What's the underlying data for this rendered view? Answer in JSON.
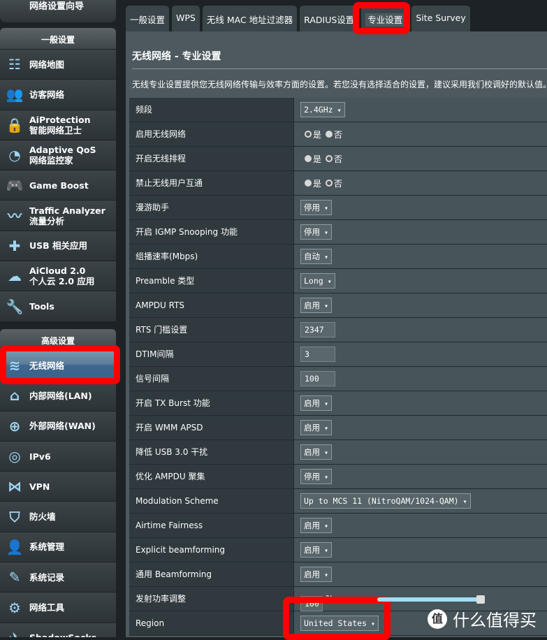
{
  "sidebar": {
    "wizard": "网络设置向导",
    "general_header": "一般设置",
    "general": [
      {
        "icon": "network-map-icon",
        "glyph": "☷",
        "label": "网络地图"
      },
      {
        "icon": "guest-network-icon",
        "glyph": "👥",
        "label": "访客网络"
      },
      {
        "icon": "lock-icon",
        "glyph": "🔒",
        "label": "AiProtection\n智能网络卫士"
      },
      {
        "icon": "gauge-icon",
        "glyph": "◔",
        "label": "Adaptive QoS\n网络监控家"
      },
      {
        "icon": "gamepad-icon",
        "glyph": "🎮",
        "label": "Game Boost"
      },
      {
        "icon": "chart-icon",
        "glyph": "〰",
        "label": "Traffic Analyzer\n流量分析"
      },
      {
        "icon": "puzzle-icon",
        "glyph": "✚",
        "label": "USB 相关应用"
      },
      {
        "icon": "cloud-icon",
        "glyph": "☁",
        "label": "AiCloud 2.0\n个人云 2.0 应用"
      },
      {
        "icon": "wrench-icon",
        "glyph": "🔧",
        "label": "Tools"
      }
    ],
    "advanced_header": "高级设置",
    "advanced": [
      {
        "icon": "wifi-icon",
        "glyph": "≋",
        "label": "无线网络",
        "active": true
      },
      {
        "icon": "home-icon",
        "glyph": "⌂",
        "label": "内部网络(LAN)"
      },
      {
        "icon": "globe-icon",
        "glyph": "⊕",
        "label": "外部网络(WAN)"
      },
      {
        "icon": "ipv6-icon",
        "glyph": "◎",
        "label": "IPv6"
      },
      {
        "icon": "vpn-icon",
        "glyph": "⋈",
        "label": "VPN"
      },
      {
        "icon": "shield-icon",
        "glyph": "⛉",
        "label": "防火墙"
      },
      {
        "icon": "admin-icon",
        "glyph": "👤",
        "label": "系统管理"
      },
      {
        "icon": "log-icon",
        "glyph": "✎",
        "label": "系统记录"
      },
      {
        "icon": "tools-icon",
        "glyph": "⚙",
        "label": "网络工具"
      },
      {
        "icon": "shadowsocks-icon",
        "glyph": "✈",
        "label": "ShadowSocks"
      }
    ]
  },
  "tabs": [
    {
      "label": "一般设置"
    },
    {
      "label": "WPS"
    },
    {
      "label": "无线 MAC 地址过滤器"
    },
    {
      "label": "RADIUS设置"
    },
    {
      "label": "专业设置",
      "selected": true
    },
    {
      "label": "Site Survey"
    }
  ],
  "page": {
    "title": "无线网络 - 专业设置",
    "description": "无线专业设置提供您无线网络传输与效率方面的设置。若您没有选择适合的设置，建议采用我们校调好的默认值。"
  },
  "radio_labels": {
    "yes": "是",
    "no": "否"
  },
  "rows": [
    {
      "label": "频段",
      "type": "select",
      "value": "2.4GHz"
    },
    {
      "label": "启用无线网络",
      "type": "radio",
      "value": "yes"
    },
    {
      "label": "开启无线排程",
      "type": "radio",
      "value": "no"
    },
    {
      "label": "禁止无线用户互通",
      "type": "radio",
      "value": "no"
    },
    {
      "label": "漫游助手",
      "type": "select",
      "value": "停用"
    },
    {
      "label": "开启 IGMP Snooping 功能",
      "type": "select",
      "value": "停用"
    },
    {
      "label": "组播速率(Mbps)",
      "type": "select",
      "value": "自动"
    },
    {
      "label": "Preamble 类型",
      "type": "select",
      "value": "Long"
    },
    {
      "label": "AMPDU RTS",
      "type": "select",
      "value": "启用"
    },
    {
      "label": "RTS 门槛设置",
      "type": "input",
      "value": "2347"
    },
    {
      "label": "DTIM间隔",
      "type": "input",
      "value": "3"
    },
    {
      "label": "信号间隔",
      "type": "input",
      "value": "100"
    },
    {
      "label": "开启 TX Burst 功能",
      "type": "select",
      "value": "启用"
    },
    {
      "label": "开启 WMM APSD",
      "type": "select",
      "value": "启用"
    },
    {
      "label": "降低 USB 3.0 干扰",
      "type": "select",
      "value": "启用"
    },
    {
      "label": "优化 AMPDU 聚集",
      "type": "select",
      "value": "停用"
    },
    {
      "label": "Modulation Scheme",
      "type": "select",
      "value": "Up to MCS 11 (NitroQAM/1024-QAM)"
    },
    {
      "label": "Airtime Fairness",
      "type": "select",
      "value": "启用"
    },
    {
      "label": "Explicit beamforming",
      "type": "select",
      "value": "启用"
    },
    {
      "label": "通用 Beamforming",
      "type": "select",
      "value": "启用"
    },
    {
      "label": "发射功率调整",
      "type": "slider",
      "value": 100,
      "unit": "%"
    },
    {
      "label": "Region",
      "type": "select",
      "value": "United States"
    }
  ],
  "colors": {
    "annotation": "#ff0000",
    "slider": "#9fe0f7",
    "active_item": "#3e6790"
  },
  "watermark": {
    "logo": "值",
    "text": "什么值得买"
  }
}
